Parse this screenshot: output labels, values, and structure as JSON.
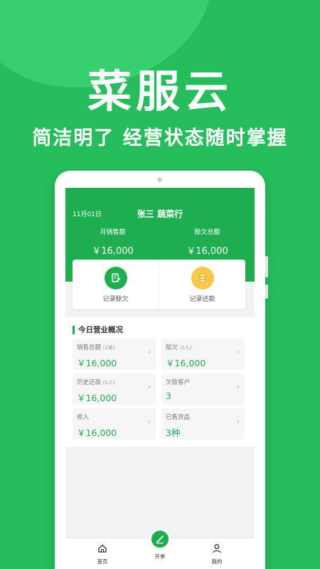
{
  "promo": {
    "title": "菜服云",
    "subtitle": "简洁明了 经营状态随时掌握"
  },
  "header": {
    "date": "11月01日",
    "shop": "张三  蔬菜行",
    "stats": [
      {
        "label": "月销售额",
        "value": "￥16,000"
      },
      {
        "label": "赊欠总额",
        "value": "￥16,000"
      }
    ]
  },
  "actions": [
    {
      "label": "记录赊欠",
      "icon": "edit-note-icon",
      "color": "#1fae4f"
    },
    {
      "label": "记录还款",
      "icon": "coins-icon",
      "color": "#f7c948"
    }
  ],
  "overview": {
    "title": "今日营业概况",
    "cards": [
      {
        "label": "销售总额",
        "sub": "(2单)",
        "value": "￥16,000"
      },
      {
        "label": "赊欠",
        "sub": "(2人)",
        "value": "￥16,000"
      },
      {
        "label": "历史还款",
        "sub": "(1人)",
        "value": "￥16,000"
      },
      {
        "label": "欠款客户",
        "sub": "",
        "value": "3"
      },
      {
        "label": "收入",
        "sub": "",
        "value": "￥16,000"
      },
      {
        "label": "已售货品",
        "sub": "",
        "value": "3种"
      }
    ]
  },
  "tabbar": {
    "home": "首页",
    "create": "开单",
    "mine": "我的"
  },
  "colors": {
    "background": "#26bd5c",
    "accent": "#1fae4f",
    "coins": "#f7c948"
  }
}
